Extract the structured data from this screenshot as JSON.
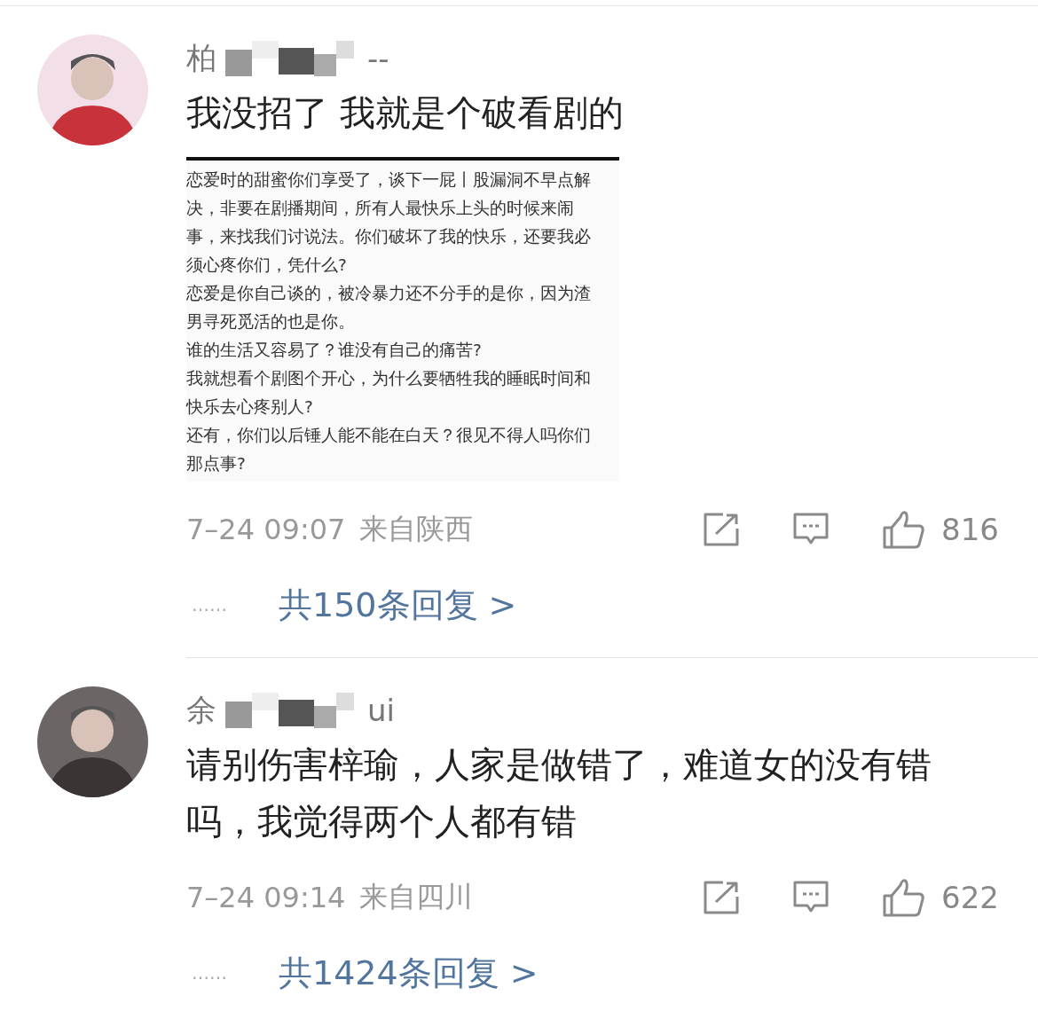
{
  "comments": [
    {
      "avatar": {
        "color": "#c8323a"
      },
      "name_parts": [
        "柏",
        "--"
      ],
      "text": "我没招了 我就是个破看剧的",
      "attachment": {
        "lines": [
          "恋爱时的甜蜜你们享受了，谈下一屁丨股漏洞不早点解",
          "决，非要在剧播期间，所有人最快乐上头的时候来闹",
          "事，来找我们讨说法。你们破坏了我的快乐，还要我必",
          "须心疼你们，凭什么?",
          "恋爱是你自己谈的，被冷暴力还不分手的是你，因为渣",
          "男寻死觅活的也是你。",
          "谁的生活又容易了？谁没有自己的痛苦?",
          "我就想看个剧图个开心，为什么要牺牲我的睡眠时间和",
          "快乐去心疼别人?",
          "还有，你们以后锤人能不能在白天？很见不得人吗你们",
          "那点事?"
        ]
      },
      "time": "7–24 09:07",
      "location": "来自陕西",
      "likes": "816",
      "dots": "……",
      "replies": "共150条回复 >"
    },
    {
      "avatar": {
        "color": "#3a3434"
      },
      "name_parts": [
        "余",
        "ui"
      ],
      "text": "请别伤害梓瑜，人家是做错了，难道女的没有错吗，我觉得两个人都有错",
      "time": "7–24 09:14",
      "location": "来自四川",
      "likes": "622",
      "dots": "……",
      "replies": "共1424条回复 >"
    }
  ]
}
